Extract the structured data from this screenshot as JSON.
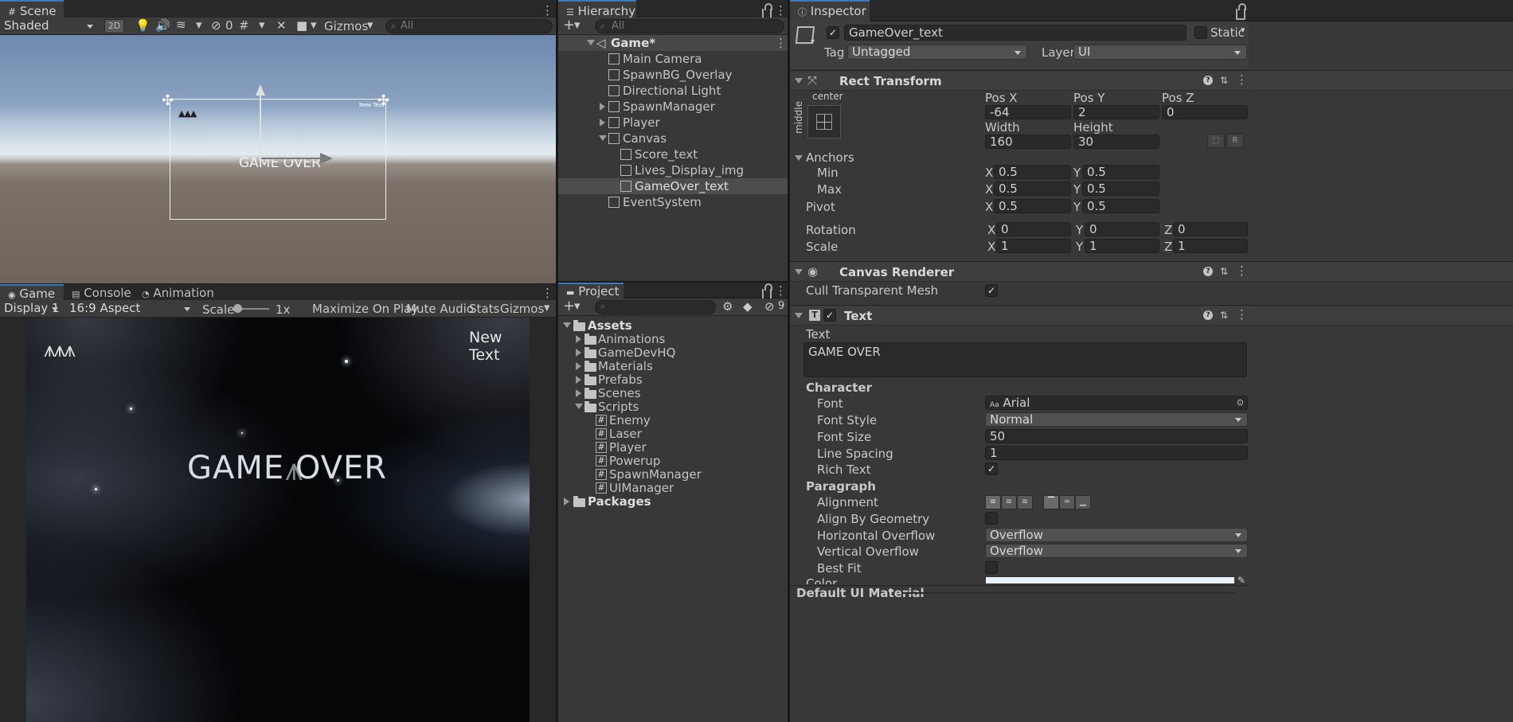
{
  "scene": {
    "tab": "Scene",
    "shading": "Shaded",
    "mode_2d": "2D",
    "hidden_count": "0",
    "gizmos": "Gizmos",
    "search_placeholder": "All",
    "canvas_label": "New Text",
    "gameover_label": "GAME OVER"
  },
  "hierarchy": {
    "tab": "Hierarchy",
    "search_placeholder": "All",
    "root": "Game*",
    "items": [
      {
        "label": "Main Camera"
      },
      {
        "label": "SpawnBG_Overlay"
      },
      {
        "label": "Directional Light"
      },
      {
        "label": "SpawnManager"
      },
      {
        "label": "Player"
      },
      {
        "label": "Canvas"
      },
      {
        "label": "Score_text"
      },
      {
        "label": "Lives_Display_img"
      },
      {
        "label": "GameOver_text"
      },
      {
        "label": "EventSystem"
      }
    ]
  },
  "game": {
    "tabs": [
      "Game",
      "Console",
      "Animation"
    ],
    "display": "Display 1",
    "aspect": "16:9 Aspect",
    "scale_label": "Scale",
    "scale_value": "1x",
    "maximize": "Maximize On Play",
    "mute": "Mute Audio",
    "stats": "Stats",
    "gizmos": "Gizmos",
    "new_text": "New Text",
    "game_over": "GAME OVER"
  },
  "project": {
    "tab": "Project",
    "hidden_count": "9",
    "assets": "Assets",
    "folders": [
      "Animations",
      "GameDevHQ",
      "Materials",
      "Prefabs",
      "Scenes",
      "Scripts"
    ],
    "scripts": [
      "Enemy",
      "Laser",
      "Player",
      "Powerup",
      "SpawnManager",
      "UIManager"
    ],
    "packages": "Packages"
  },
  "inspector": {
    "tab": "Inspector",
    "object_name": "GameOver_text",
    "static_label": "Static",
    "tag_label": "Tag",
    "tag_value": "Untagged",
    "layer_label": "Layer",
    "layer_value": "UI",
    "rect": {
      "title": "Rect Transform",
      "anchor_h": "center",
      "anchor_v": "middle",
      "posx_label": "Pos X",
      "posx": "-64",
      "posy_label": "Pos Y",
      "posy": "2",
      "posz_label": "Pos Z",
      "posz": "0",
      "width_label": "Width",
      "width": "160",
      "height_label": "Height",
      "height": "30",
      "anchors": "Anchors",
      "min": "Min",
      "min_x": "0.5",
      "min_y": "0.5",
      "max": "Max",
      "max_x": "0.5",
      "max_y": "0.5",
      "pivot": "Pivot",
      "pivot_x": "0.5",
      "pivot_y": "0.5",
      "rotation": "Rotation",
      "rot_x": "0",
      "rot_y": "0",
      "rot_z": "0",
      "scale": "Scale",
      "sc_x": "1",
      "sc_y": "1",
      "sc_z": "1",
      "x": "X",
      "y": "Y",
      "z": "Z"
    },
    "renderer": {
      "title": "Canvas Renderer",
      "cull": "Cull Transparent Mesh"
    },
    "text": {
      "title": "Text",
      "text_label": "Text",
      "text_value": "GAME OVER",
      "character": "Character",
      "font_label": "Font",
      "font_value": "Arial",
      "font_prefix": "Aa",
      "style_label": "Font Style",
      "style_value": "Normal",
      "size_label": "Font Size",
      "size_value": "50",
      "spacing_label": "Line Spacing",
      "spacing_value": "1",
      "rich_label": "Rich Text",
      "paragraph": "Paragraph",
      "alignment": "Alignment",
      "align_geom": "Align By Geometry",
      "hover_label": "Horizontal Overflow",
      "hover_value": "Overflow",
      "vover_label": "Vertical Overflow",
      "vover_value": "Overflow",
      "best_fit": "Best Fit",
      "color": "Color"
    },
    "material": "Default UI Material"
  },
  "colors": {
    "accent": "#3a79bb",
    "panel": "#383838",
    "field": "#2a2a2a",
    "selected_row": "#4d4d4d"
  }
}
